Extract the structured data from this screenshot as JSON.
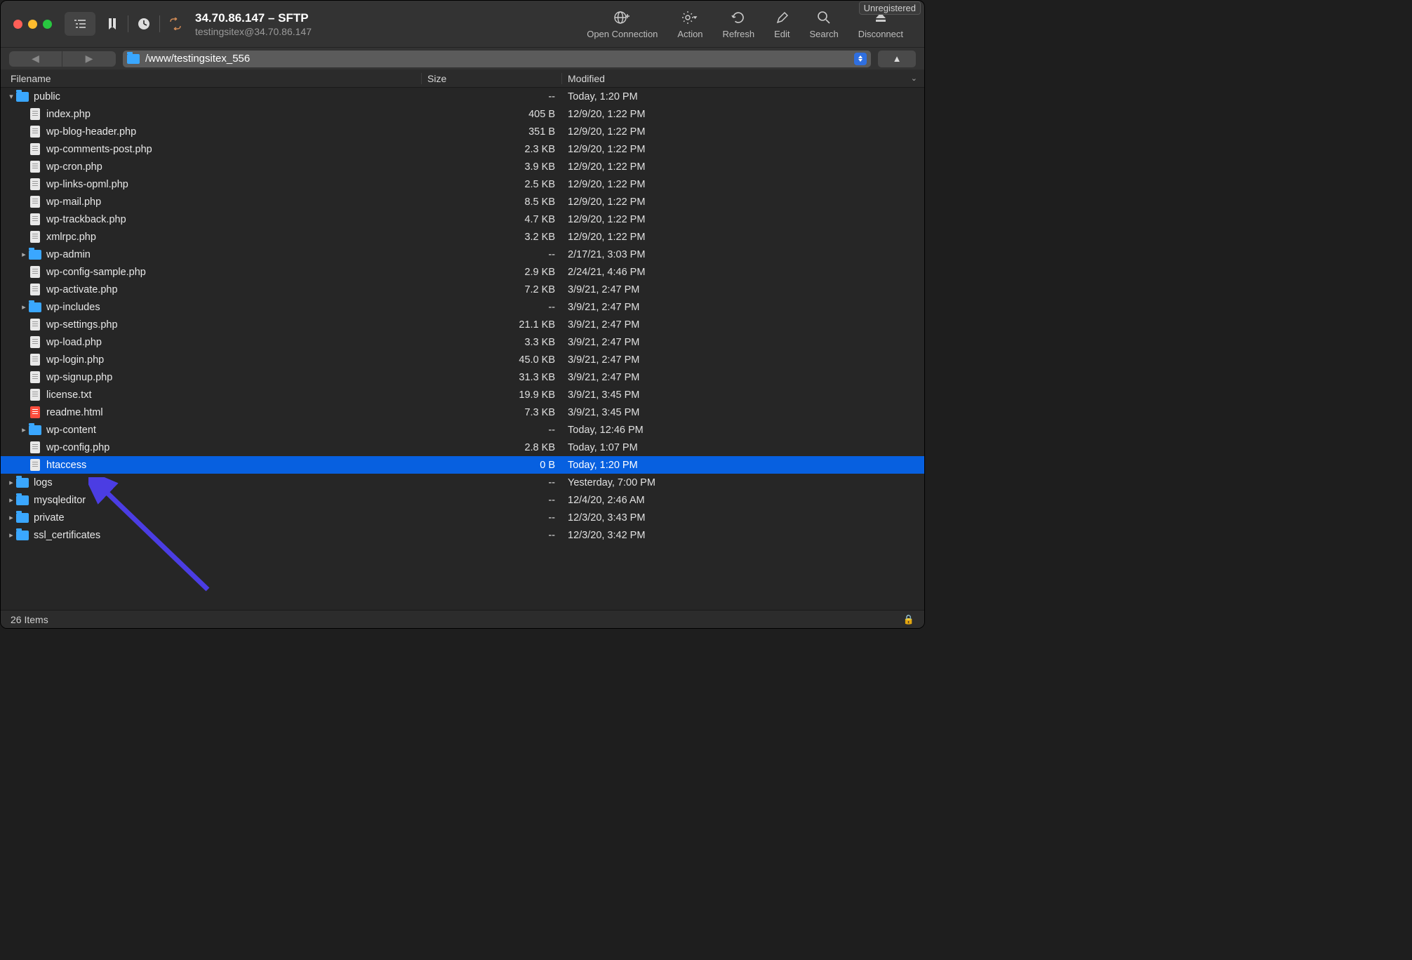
{
  "registration_badge": "Unregistered",
  "connection": {
    "title": "34.70.86.147 – SFTP",
    "subtitle": "testingsitex@34.70.86.147"
  },
  "toolbar": {
    "open_connection": "Open Connection",
    "action": "Action",
    "refresh": "Refresh",
    "edit": "Edit",
    "search": "Search",
    "disconnect": "Disconnect"
  },
  "path": "/www/testingsitex_556",
  "columns": {
    "name": "Filename",
    "size": "Size",
    "modified": "Modified"
  },
  "files": [
    {
      "indent": 0,
      "type": "folder",
      "disclosure": "down",
      "name": "public",
      "size": "--",
      "modified": "Today, 1:20 PM"
    },
    {
      "indent": 1,
      "type": "file",
      "name": "index.php",
      "size": "405 B",
      "modified": "12/9/20, 1:22 PM"
    },
    {
      "indent": 1,
      "type": "file",
      "name": "wp-blog-header.php",
      "size": "351 B",
      "modified": "12/9/20, 1:22 PM"
    },
    {
      "indent": 1,
      "type": "file",
      "name": "wp-comments-post.php",
      "size": "2.3 KB",
      "modified": "12/9/20, 1:22 PM"
    },
    {
      "indent": 1,
      "type": "file",
      "name": "wp-cron.php",
      "size": "3.9 KB",
      "modified": "12/9/20, 1:22 PM"
    },
    {
      "indent": 1,
      "type": "file",
      "name": "wp-links-opml.php",
      "size": "2.5 KB",
      "modified": "12/9/20, 1:22 PM"
    },
    {
      "indent": 1,
      "type": "file",
      "name": "wp-mail.php",
      "size": "8.5 KB",
      "modified": "12/9/20, 1:22 PM"
    },
    {
      "indent": 1,
      "type": "file",
      "name": "wp-trackback.php",
      "size": "4.7 KB",
      "modified": "12/9/20, 1:22 PM"
    },
    {
      "indent": 1,
      "type": "file",
      "name": "xmlrpc.php",
      "size": "3.2 KB",
      "modified": "12/9/20, 1:22 PM"
    },
    {
      "indent": 1,
      "type": "folder",
      "disclosure": "right",
      "name": "wp-admin",
      "size": "--",
      "modified": "2/17/21, 3:03 PM"
    },
    {
      "indent": 1,
      "type": "file",
      "name": "wp-config-sample.php",
      "size": "2.9 KB",
      "modified": "2/24/21, 4:46 PM"
    },
    {
      "indent": 1,
      "type": "file",
      "name": "wp-activate.php",
      "size": "7.2 KB",
      "modified": "3/9/21, 2:47 PM"
    },
    {
      "indent": 1,
      "type": "folder",
      "disclosure": "right",
      "name": "wp-includes",
      "size": "--",
      "modified": "3/9/21, 2:47 PM"
    },
    {
      "indent": 1,
      "type": "file",
      "name": "wp-settings.php",
      "size": "21.1 KB",
      "modified": "3/9/21, 2:47 PM"
    },
    {
      "indent": 1,
      "type": "file",
      "name": "wp-load.php",
      "size": "3.3 KB",
      "modified": "3/9/21, 2:47 PM"
    },
    {
      "indent": 1,
      "type": "file",
      "name": "wp-login.php",
      "size": "45.0 KB",
      "modified": "3/9/21, 2:47 PM"
    },
    {
      "indent": 1,
      "type": "file",
      "name": "wp-signup.php",
      "size": "31.3 KB",
      "modified": "3/9/21, 2:47 PM"
    },
    {
      "indent": 1,
      "type": "file",
      "name": "license.txt",
      "size": "19.9 KB",
      "modified": "3/9/21, 3:45 PM"
    },
    {
      "indent": 1,
      "type": "file",
      "icon": "red",
      "name": "readme.html",
      "size": "7.3 KB",
      "modified": "3/9/21, 3:45 PM"
    },
    {
      "indent": 1,
      "type": "folder",
      "disclosure": "right",
      "name": "wp-content",
      "size": "--",
      "modified": "Today, 12:46 PM"
    },
    {
      "indent": 1,
      "type": "file",
      "name": "wp-config.php",
      "size": "2.8 KB",
      "modified": "Today, 1:07 PM"
    },
    {
      "indent": 1,
      "type": "file",
      "name": "htaccess",
      "size": "0 B",
      "modified": "Today, 1:20 PM",
      "selected": true
    },
    {
      "indent": 0,
      "type": "folder",
      "disclosure": "right",
      "name": "logs",
      "size": "--",
      "modified": "Yesterday, 7:00 PM"
    },
    {
      "indent": 0,
      "type": "folder",
      "disclosure": "right",
      "name": "mysqleditor",
      "size": "--",
      "modified": "12/4/20, 2:46 AM"
    },
    {
      "indent": 0,
      "type": "folder",
      "disclosure": "right",
      "name": "private",
      "size": "--",
      "modified": "12/3/20, 3:43 PM"
    },
    {
      "indent": 0,
      "type": "folder",
      "disclosure": "right",
      "name": "ssl_certificates",
      "size": "--",
      "modified": "12/3/20, 3:42 PM"
    }
  ],
  "status": {
    "item_count": "26 Items"
  },
  "accent": "#0760e0",
  "arrow_color": "#4b3de3"
}
